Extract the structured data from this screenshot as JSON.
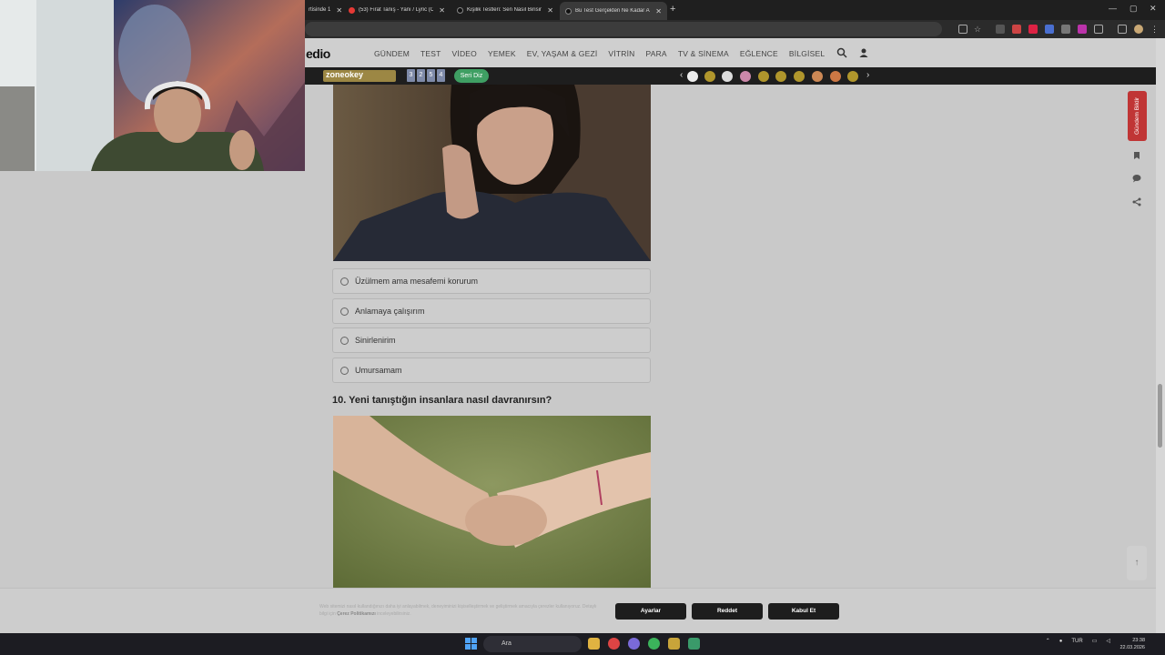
{
  "browser": {
    "tabs": [
      {
        "label": "rtisinde 1",
        "fav_color": "#888888",
        "active": false
      },
      {
        "label": "(53) Fırat Tanış - Yanı / Lyric (Offi",
        "fav_color": "#e53935",
        "active": false
      },
      {
        "label": "Kişilik Testleri: Sen Nasıl Birisin?",
        "fav_color": "#222222",
        "active": false
      },
      {
        "label": "Bu Test Gerçekten Ne Kadar Az",
        "fav_color": "#222222",
        "active": true
      }
    ],
    "new_tab": "+",
    "window_controls": [
      "—",
      "▢",
      "✕"
    ]
  },
  "site": {
    "logo": "edio",
    "nav": [
      "GÜNDEM",
      "TEST",
      "VİDEO",
      "YEMEK",
      "EV, YAŞAM & GEZİ",
      "VİTRİN",
      "PARA",
      "TV & SİNEMA",
      "EĞLENCE",
      "BİLGİSEL"
    ],
    "subbar": {
      "zone_badge": "zoneokey",
      "numbers": [
        "3",
        "2",
        "5",
        "4"
      ],
      "seri_diz": "Seri Diz",
      "prev": "‹",
      "next": "›"
    }
  },
  "question_options": [
    "Üzülmem ama mesafemi korurum",
    "Anlamaya çalışırım",
    "Sinirlenirim",
    "Umursamam"
  ],
  "question10": {
    "title": "10. Yeni tanıştığın insanlara nasıl davranırsın?"
  },
  "sidebar": {
    "gundem_label": "Gündem Bildir",
    "top_arrow": "↑"
  },
  "cookie": {
    "text_start": "Web sitemizi nasıl kullandığınızı daha iyi anlayabilmek, deneyiminizi kişiselleştirmek ve geliştirmek amacıyla çerezler kullanıyoruz. Detaylı bilgi için",
    "policy_link": "Çerez Politikamızı",
    "text_end": "inceleyebilirsiniz.",
    "buttons": {
      "settings": "Ayarlar",
      "reject": "Reddet",
      "accept": "Kabul Et"
    }
  },
  "taskbar": {
    "search_placeholder": "Ara",
    "lang": "TUR",
    "time": "23:38",
    "date": "22.03.2026"
  },
  "colors": {
    "accent_red": "#c03535",
    "seri_green": "#3f9f63",
    "cookie_btn": "#1d1d1d"
  }
}
